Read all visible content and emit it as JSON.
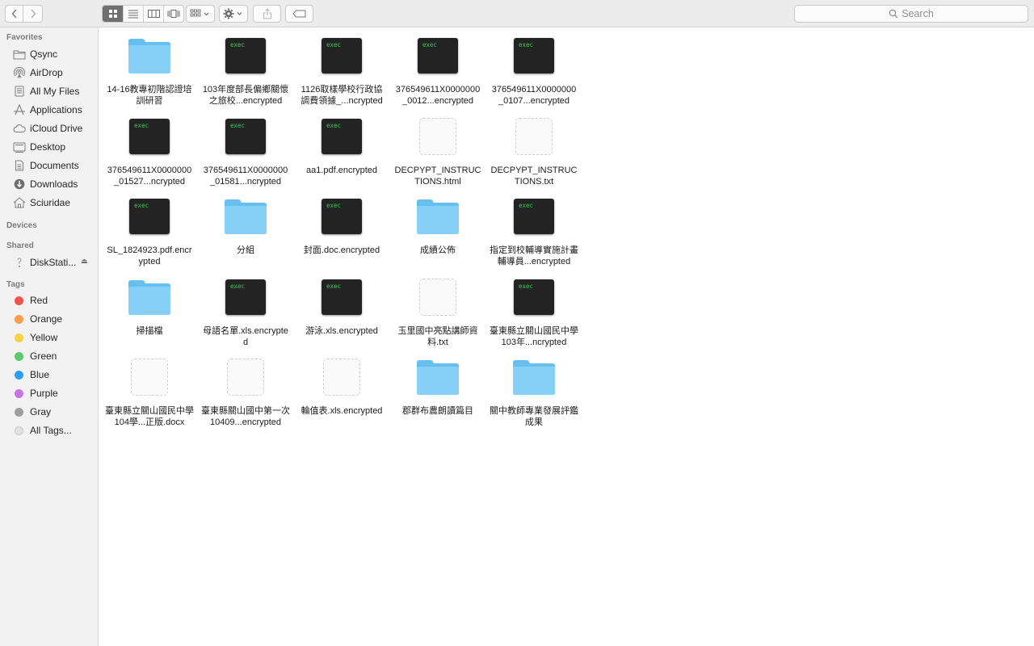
{
  "toolbar": {
    "back_icon": "chevron-left-icon",
    "forward_icon": "chevron-right-icon",
    "views": [
      "icon-view",
      "list-view",
      "column-view",
      "cover-flow-view"
    ],
    "active_view": "icon-view",
    "search_placeholder": "Search"
  },
  "sidebar": {
    "favorites_header": "Favorites",
    "favorites": [
      {
        "label": "Qsync",
        "icon": "folder-icon"
      },
      {
        "label": "AirDrop",
        "icon": "airdrop-icon"
      },
      {
        "label": "All My Files",
        "icon": "all-files-icon"
      },
      {
        "label": "Applications",
        "icon": "applications-icon"
      },
      {
        "label": "iCloud Drive",
        "icon": "cloud-icon"
      },
      {
        "label": "Desktop",
        "icon": "desktop-icon"
      },
      {
        "label": "Documents",
        "icon": "documents-icon"
      },
      {
        "label": "Downloads",
        "icon": "downloads-icon"
      },
      {
        "label": "Sciuridae",
        "icon": "home-icon"
      }
    ],
    "devices_header": "Devices",
    "shared_header": "Shared",
    "shared": [
      {
        "label": "DiskStati...",
        "icon": "network-server-icon"
      }
    ],
    "tags_header": "Tags",
    "tags": [
      {
        "label": "Red",
        "color": "#ef5350"
      },
      {
        "label": "Orange",
        "color": "#f6a04d"
      },
      {
        "label": "Yellow",
        "color": "#f8d347"
      },
      {
        "label": "Green",
        "color": "#5cc96a"
      },
      {
        "label": "Blue",
        "color": "#2e9ef3"
      },
      {
        "label": "Purple",
        "color": "#c874e2"
      },
      {
        "label": "Gray",
        "color": "#9e9e9e"
      },
      {
        "label": "All Tags...",
        "color": "#e2e2e2"
      }
    ]
  },
  "files": [
    {
      "name": "14-16教專初階認證培訓研習",
      "type": "folder"
    },
    {
      "name": "103年度部長偏鄉關懷之旅校...encrypted",
      "type": "exec"
    },
    {
      "name": "1126取樣學校行政協調費領據_...ncrypted",
      "type": "exec"
    },
    {
      "name": "376549611X0000000_0012...encrypted",
      "type": "exec"
    },
    {
      "name": "376549611X0000000_0107...encrypted",
      "type": "exec"
    },
    {
      "name": "376549611X0000000_01527...ncrypted",
      "type": "exec"
    },
    {
      "name": "376549611X0000000_01581...ncrypted",
      "type": "exec"
    },
    {
      "name": "aa1.pdf.encrypted",
      "type": "exec"
    },
    {
      "name": "DECPYPT_INSTRUCTIONS.html",
      "type": "blank"
    },
    {
      "name": "DECPYPT_INSTRUCTIONS.txt",
      "type": "blank"
    },
    {
      "name": "SL_1824923.pdf.encrypted",
      "type": "exec"
    },
    {
      "name": "分組",
      "type": "folder"
    },
    {
      "name": "封面.doc.encrypted",
      "type": "exec"
    },
    {
      "name": "成績公佈",
      "type": "folder"
    },
    {
      "name": "指定到校輔導實施計畫輔導員...encrypted",
      "type": "exec"
    },
    {
      "name": "掃描檔",
      "type": "folder"
    },
    {
      "name": "母語名單.xls.encrypted",
      "type": "exec"
    },
    {
      "name": "游泳.xls.encrypted",
      "type": "exec"
    },
    {
      "name": "玉里國中亮點講師資料.txt",
      "type": "blank"
    },
    {
      "name": "臺東縣立關山國民中學103年...ncrypted",
      "type": "exec"
    },
    {
      "name": "臺東縣立關山國民中學104學...正版.docx",
      "type": "blank"
    },
    {
      "name": "臺東縣關山國中第一次10409...encrypted",
      "type": "blank"
    },
    {
      "name": "輪值表.xls.encrypted",
      "type": "blank"
    },
    {
      "name": "郡群布農朗讀篇目",
      "type": "folder"
    },
    {
      "name": "關中教師專業發展評鑑成果",
      "type": "folder"
    }
  ],
  "exec_label": "exec"
}
